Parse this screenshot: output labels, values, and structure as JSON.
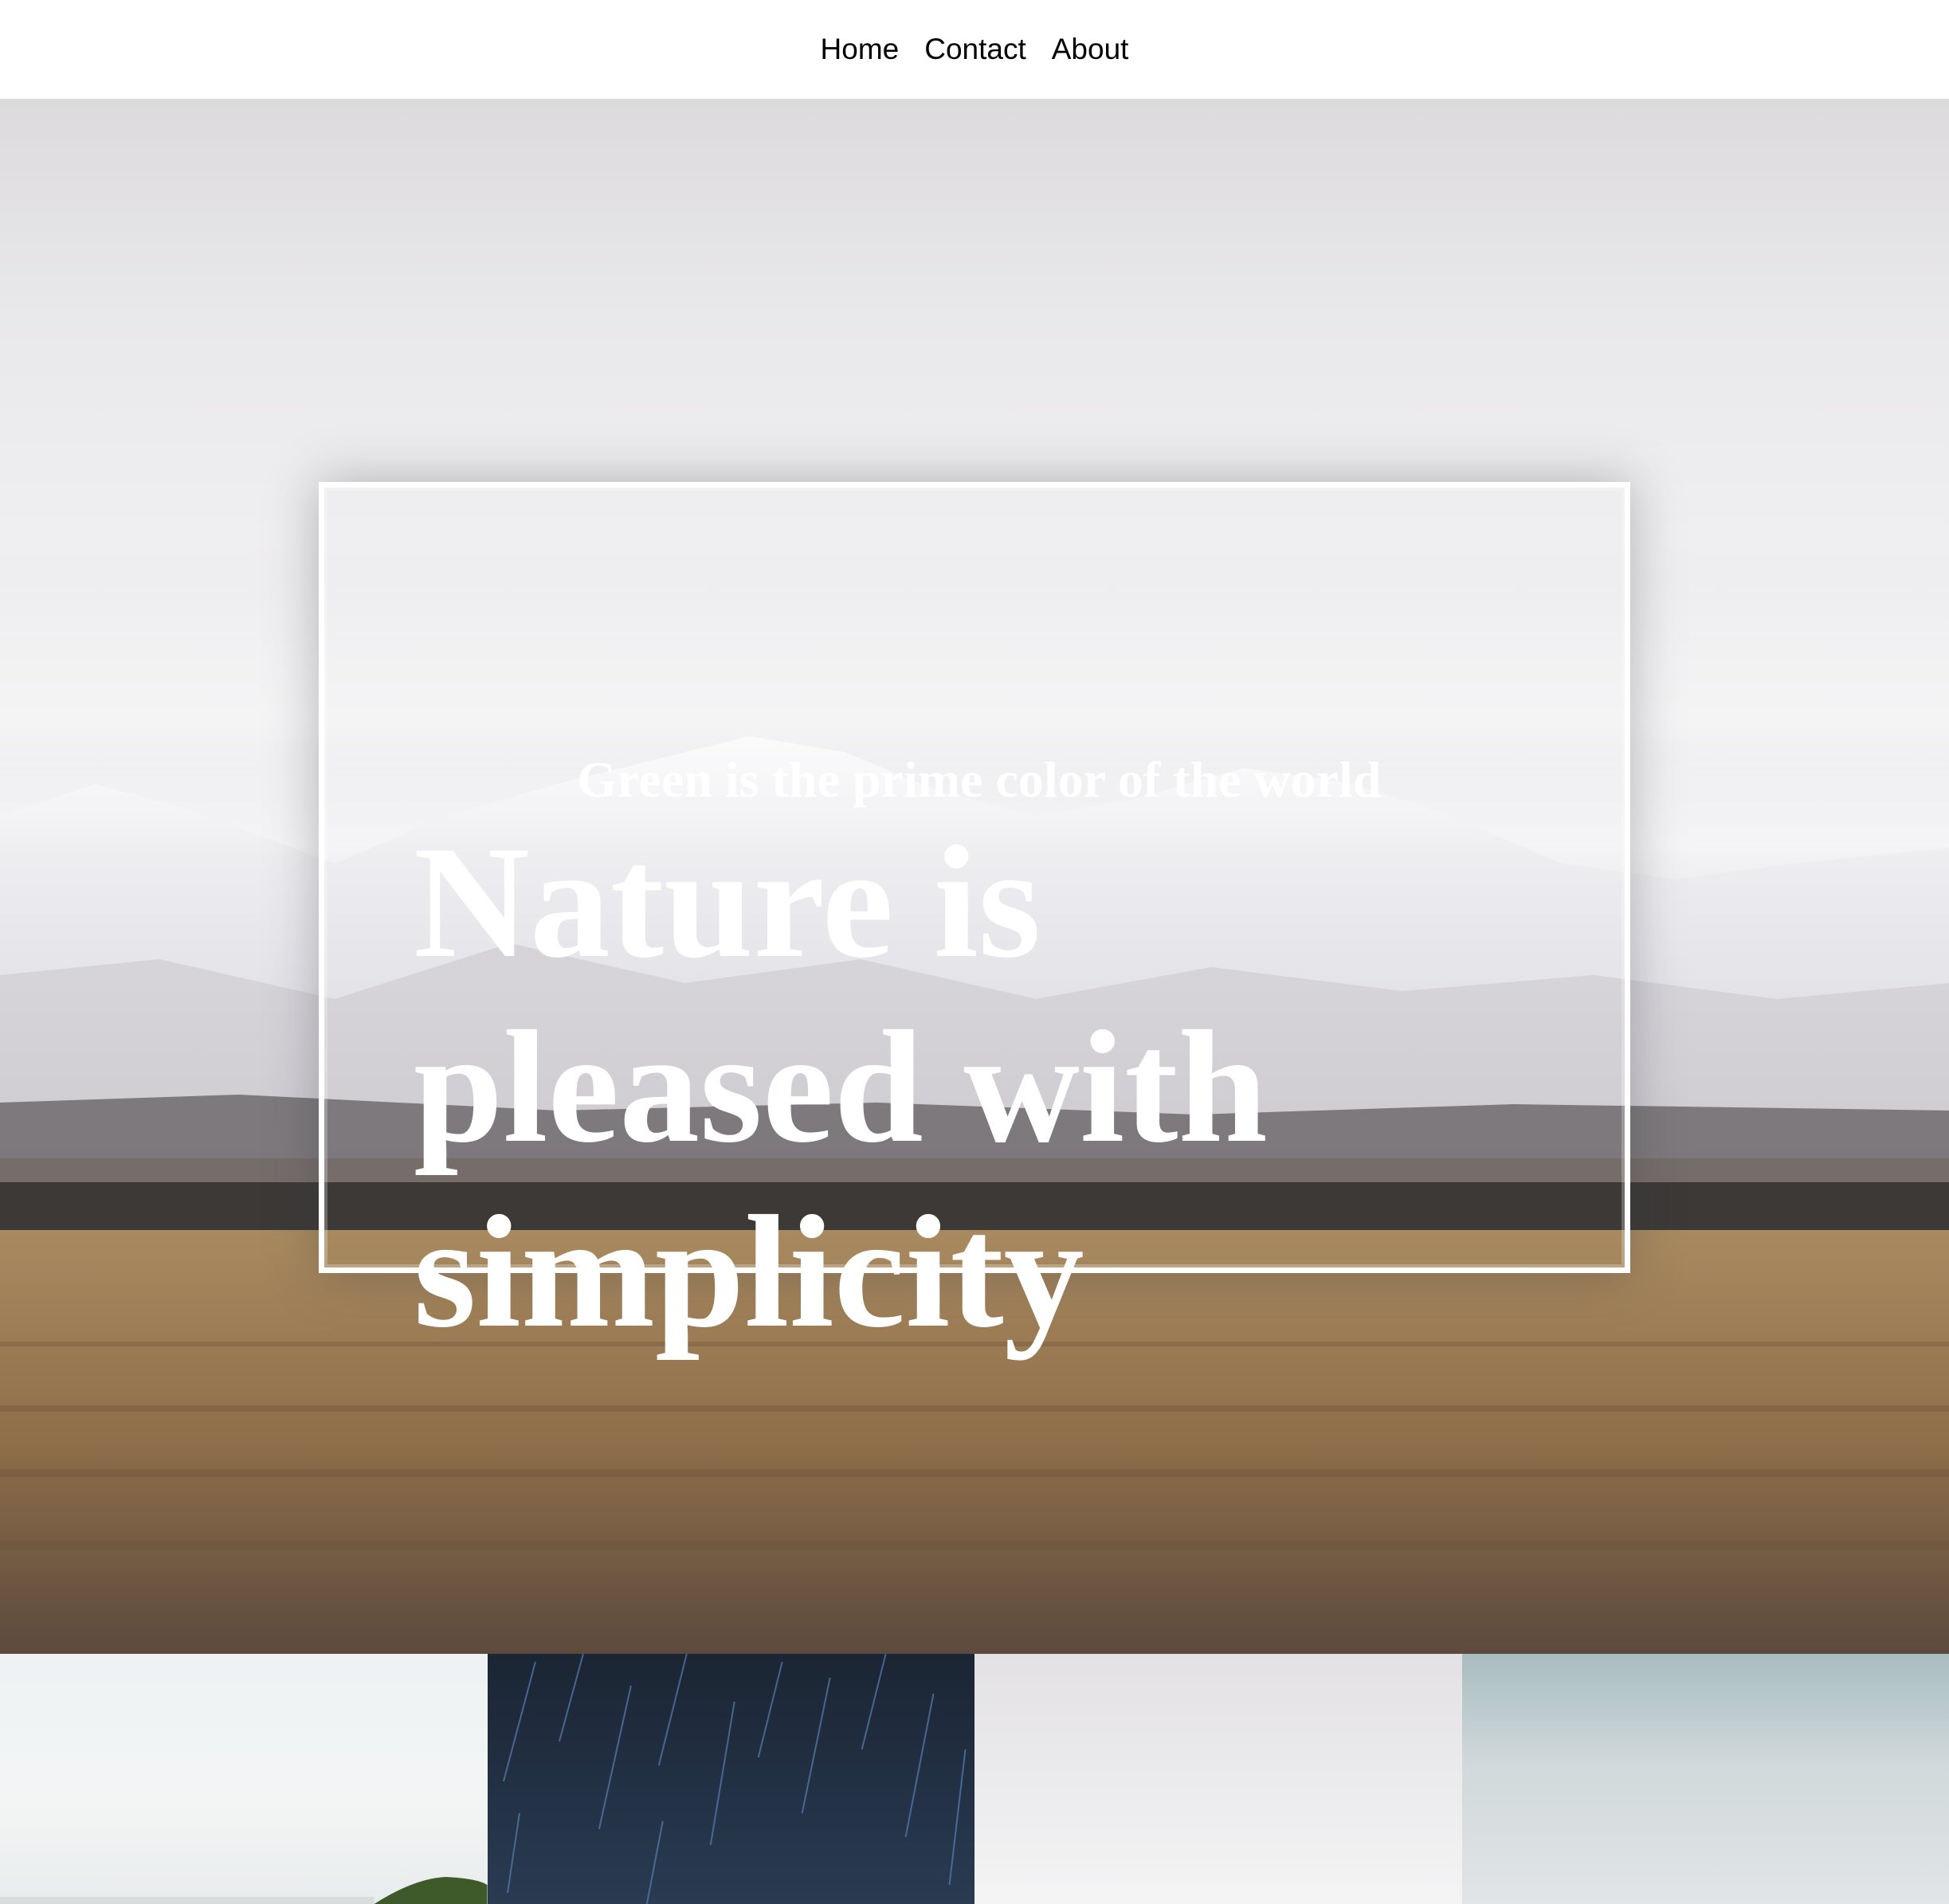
{
  "nav": {
    "items": [
      {
        "label": "Home"
      },
      {
        "label": "Contact"
      },
      {
        "label": "About"
      }
    ]
  },
  "hero": {
    "subtitle": "Green is the prime color of the world",
    "title": "Nature is pleased with simplicity",
    "image": "snowy-mountains-grassland-photo"
  },
  "thumbnails": [
    {
      "image": "hill-sky-photo"
    },
    {
      "image": "star-trails-night-photo"
    },
    {
      "image": "cloudy-sky-photo"
    },
    {
      "image": "overcast-clouds-photo"
    }
  ],
  "colors": {
    "nav_background": "#ffffff",
    "nav_text": "#000000",
    "hero_text": "#ffffff",
    "frame_border": "#ffffff"
  }
}
